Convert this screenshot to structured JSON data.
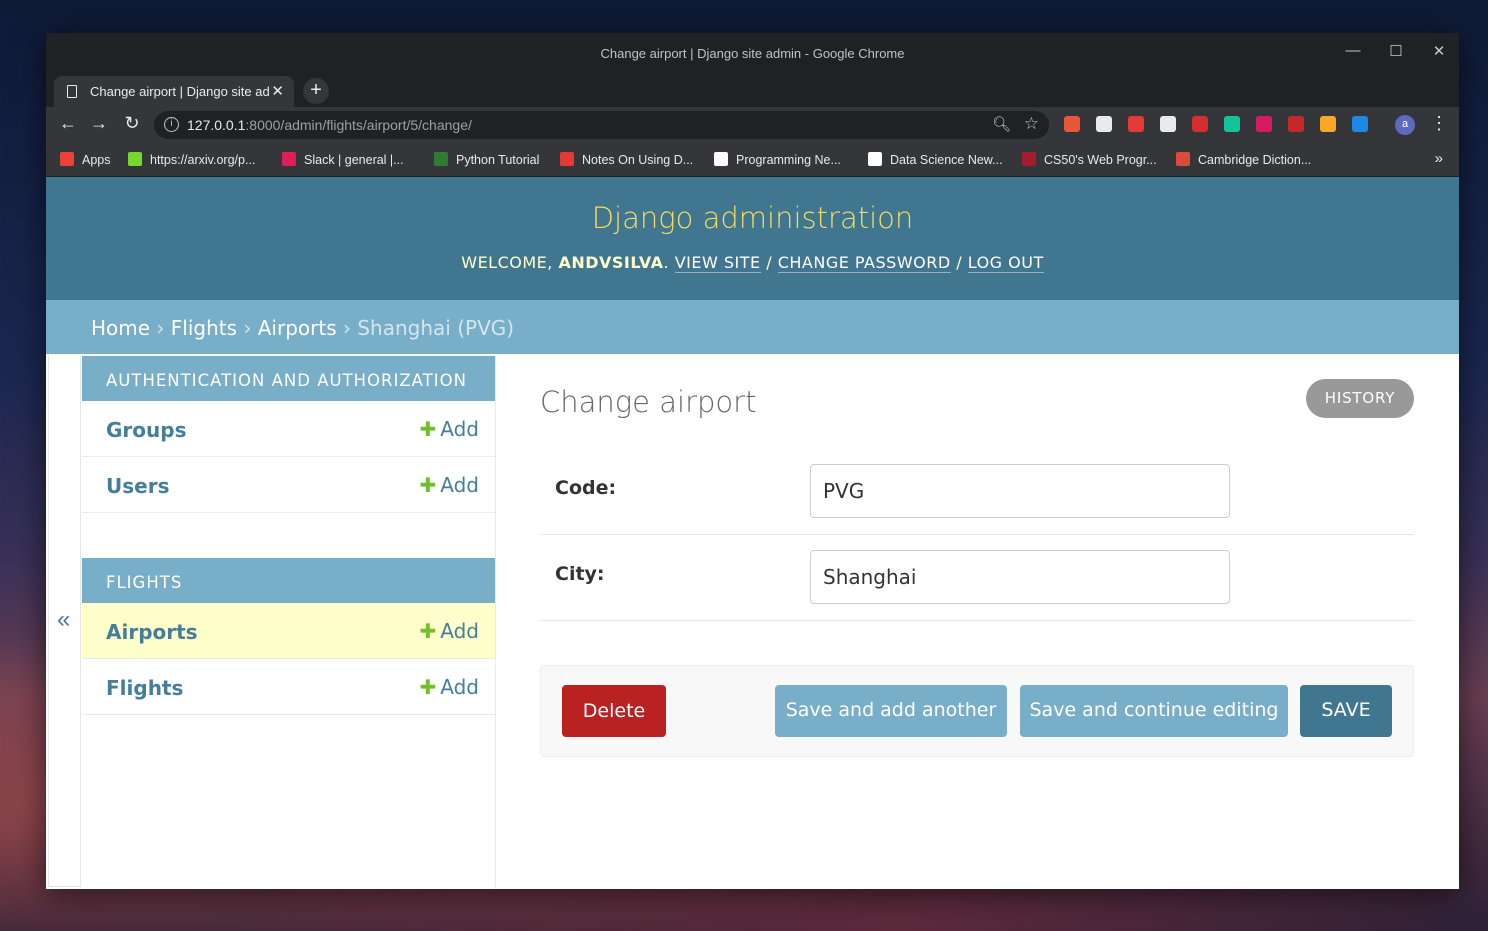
{
  "window": {
    "title": "Change airport | Django site admin - Google Chrome",
    "minimize": "—",
    "maximize": "☐",
    "close": "✕"
  },
  "tab": {
    "title": "Change airport | Django site admin",
    "close": "✕",
    "new_tab": "+"
  },
  "nav": {
    "back": "←",
    "forward": "→",
    "reload": "↻"
  },
  "omnibox": {
    "host": "127.0.0.1",
    "path": ":8000/admin/flights/airport/5/change/"
  },
  "extensions": [
    {
      "name": "ext-1",
      "color": "#e8573a"
    },
    {
      "name": "ext-2",
      "color": "#e8eaed"
    },
    {
      "name": "ext-3",
      "color": "#e53935"
    },
    {
      "name": "ext-4",
      "color": "#e8eaed"
    },
    {
      "name": "adblock-plus",
      "color": "#d32f2f"
    },
    {
      "name": "grammarly",
      "color": "#15c39a"
    },
    {
      "name": "ext-6",
      "color": "#d81b60"
    },
    {
      "name": "ext-ads",
      "color": "#c62828"
    },
    {
      "name": "ext-8",
      "color": "#f9a825"
    },
    {
      "name": "ext-9",
      "color": "#1e88e5"
    }
  ],
  "profile_initial": "a",
  "bookmarks": [
    {
      "label": "Apps",
      "icon": "apps-grid",
      "color": "#ea4335"
    },
    {
      "label": "https://arxiv.org/p...",
      "icon": "smiley",
      "color": "#76d72c"
    },
    {
      "label": "Slack | general |...",
      "icon": "slack",
      "color": "#e01e5a"
    },
    {
      "label": "Python Tutorial",
      "icon": "w3",
      "color": "#2e7d32"
    },
    {
      "label": "Notes On Using D...",
      "icon": "square",
      "color": "#e53935"
    },
    {
      "label": "Programming Ne...",
      "icon": "medium",
      "color": "#ffffff"
    },
    {
      "label": "Data Science New...",
      "icon": "medium",
      "color": "#ffffff"
    },
    {
      "label": "CS50's Web Progr...",
      "icon": "harvard",
      "color": "#a51c30"
    },
    {
      "label": "Cambridge Diction...",
      "icon": "cambridge",
      "color": "#d84b3d"
    }
  ],
  "bookmarks_more": "»",
  "admin": {
    "branding": "Django administration",
    "welcome": "WELCOME, ",
    "user": "ANDVSILVA",
    "view_site": "VIEW SITE",
    "change_password": "CHANGE PASSWORD",
    "log_out": "LOG OUT",
    "sep": " / "
  },
  "breadcrumbs": {
    "home": "Home",
    "app": "Flights",
    "model": "Airports",
    "current": "Shanghai (PVG)",
    "sep": " › "
  },
  "sidebar": {
    "toggle": "«",
    "modules": [
      {
        "caption": "Authentication and Authorization",
        "rows": [
          {
            "name": "Groups",
            "add": "Add",
            "current": false
          },
          {
            "name": "Users",
            "add": "Add",
            "current": false
          }
        ]
      },
      {
        "caption": "Flights",
        "rows": [
          {
            "name": "Airports",
            "add": "Add",
            "current": true
          },
          {
            "name": "Flights",
            "add": "Add",
            "current": false
          }
        ]
      }
    ]
  },
  "content": {
    "title": "Change airport",
    "history": "HISTORY",
    "fields": [
      {
        "label": "Code:",
        "value": "PVG"
      },
      {
        "label": "City:",
        "value": "Shanghai"
      }
    ],
    "buttons": {
      "delete": "Delete",
      "save_add": "Save and add another",
      "save_continue": "Save and continue editing",
      "save": "SAVE"
    }
  }
}
